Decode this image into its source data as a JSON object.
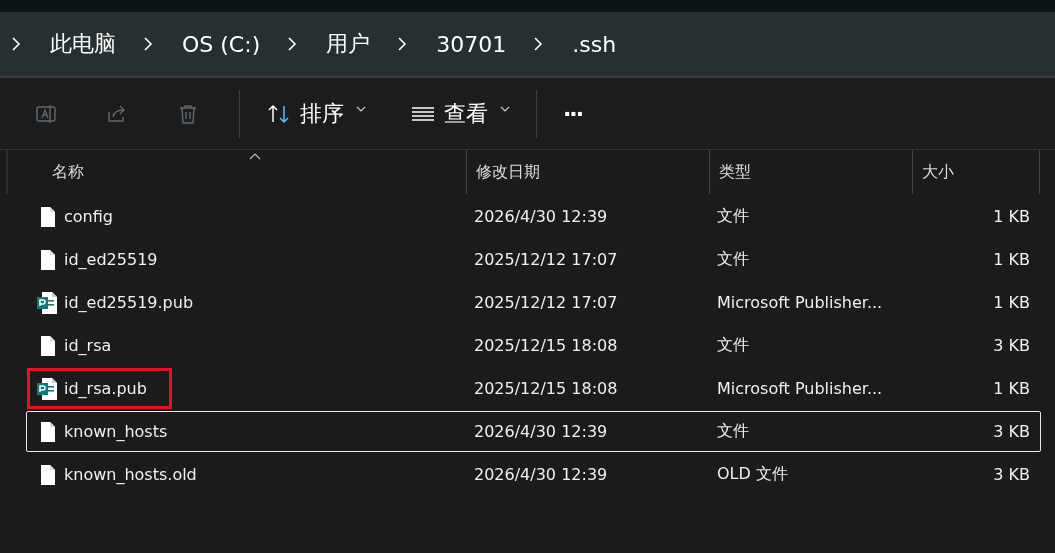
{
  "breadcrumb": [
    {
      "label": "此电脑"
    },
    {
      "label": "OS (C:)"
    },
    {
      "label": "用户"
    },
    {
      "label": "30701"
    },
    {
      "label": ".ssh"
    }
  ],
  "toolbar": [
    {
      "kind": "rename",
      "disabled": true
    },
    {
      "kind": "share",
      "disabled": true
    },
    {
      "kind": "delete",
      "disabled": true
    },
    {
      "kind": "sort",
      "label": "排序"
    },
    {
      "kind": "view",
      "label": "查看"
    },
    {
      "kind": "more",
      "label": "···"
    }
  ],
  "columns": [
    {
      "label": "名称",
      "sorted": true
    },
    {
      "label": "修改日期",
      "sorted": false
    },
    {
      "label": "类型",
      "sorted": false
    },
    {
      "label": "大小",
      "sorted": false
    }
  ],
  "files": [
    {
      "name": "config",
      "modified": "2026/4/30 12:39",
      "type": "文件",
      "size": "1 KB",
      "kind": "file",
      "focused": false,
      "marked": false
    },
    {
      "name": "id_ed25519",
      "modified": "2025/12/12 17:07",
      "type": "文件",
      "size": "1 KB",
      "kind": "file",
      "focused": false,
      "marked": false
    },
    {
      "name": "id_ed25519.pub",
      "modified": "2025/12/12 17:07",
      "type": "Microsoft Publisher...",
      "size": "1 KB",
      "kind": "publisher",
      "focused": false,
      "marked": false
    },
    {
      "name": "id_rsa",
      "modified": "2025/12/15 18:08",
      "type": "文件",
      "size": "3 KB",
      "kind": "file",
      "focused": false,
      "marked": false
    },
    {
      "name": "id_rsa.pub",
      "modified": "2025/12/15 18:08",
      "type": "Microsoft Publisher...",
      "size": "1 KB",
      "kind": "publisher",
      "focused": false,
      "marked": true
    },
    {
      "name": "known_hosts",
      "modified": "2026/4/30 12:39",
      "type": "文件",
      "size": "3 KB",
      "kind": "file",
      "focused": true,
      "marked": false
    },
    {
      "name": "known_hosts.old",
      "modified": "2026/4/30 12:39",
      "type": "OLD 文件",
      "size": "3 KB",
      "kind": "file",
      "focused": false,
      "marked": false
    }
  ]
}
